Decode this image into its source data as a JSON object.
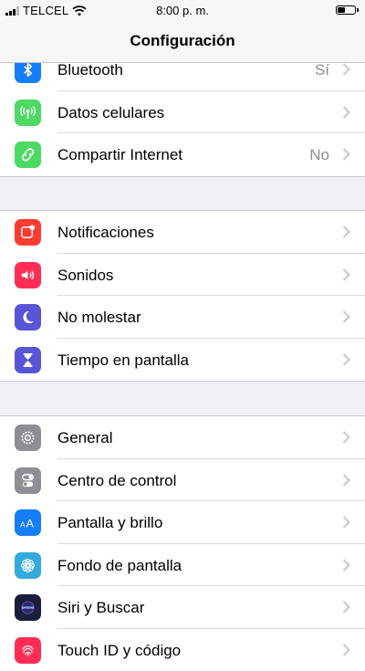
{
  "status_bar": {
    "carrier": "TELCEL",
    "time": "8:00 p. m.",
    "signal_bars": 3,
    "battery_level": 0.45
  },
  "nav": {
    "title": "Configuración"
  },
  "groups": [
    {
      "items": [
        {
          "label": "Bluetooth",
          "value": "Sí",
          "icon": "bluetooth-icon",
          "color": "#147efb"
        },
        {
          "label": "Datos celulares",
          "value": "",
          "icon": "antenna-icon",
          "color": "#4cd964"
        },
        {
          "label": "Compartir Internet",
          "value": "No",
          "icon": "hotspot-icon",
          "color": "#4cd964"
        }
      ]
    },
    {
      "items": [
        {
          "label": "Notificaciones",
          "value": "",
          "icon": "notifications-icon",
          "color": "#ff3b30"
        },
        {
          "label": "Sonidos",
          "value": "",
          "icon": "speaker-icon",
          "color": "#ff2d55"
        },
        {
          "label": "No molestar",
          "value": "",
          "icon": "moon-icon",
          "color": "#5856d6"
        },
        {
          "label": "Tiempo en pantalla",
          "value": "",
          "icon": "hourglass-icon",
          "color": "#5856d6"
        }
      ]
    },
    {
      "items": [
        {
          "label": "General",
          "value": "",
          "icon": "gear-icon",
          "color": "#8e8e93"
        },
        {
          "label": "Centro de control",
          "value": "",
          "icon": "toggles-icon",
          "color": "#8e8e93"
        },
        {
          "label": "Pantalla y brillo",
          "value": "",
          "icon": "text-size-icon",
          "color": "#147efb"
        },
        {
          "label": "Fondo de pantalla",
          "value": "",
          "icon": "flower-icon",
          "color": "#34aadc"
        },
        {
          "label": "Siri y Buscar",
          "value": "",
          "icon": "siri-icon",
          "color": "#1c1c3c"
        },
        {
          "label": "Touch ID y código",
          "value": "",
          "icon": "fingerprint-icon",
          "color": "#ff2d55"
        }
      ]
    }
  ]
}
